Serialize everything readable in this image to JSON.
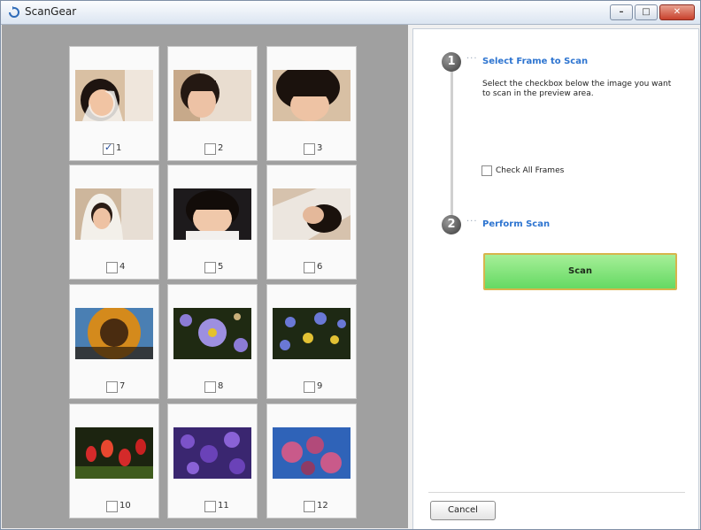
{
  "window": {
    "title": "ScanGear",
    "controls": [
      "minimize",
      "maximize",
      "close"
    ]
  },
  "frames": [
    {
      "number": "1",
      "checked": true
    },
    {
      "number": "2",
      "checked": false
    },
    {
      "number": "3",
      "checked": false
    },
    {
      "number": "4",
      "checked": false
    },
    {
      "number": "5",
      "checked": false
    },
    {
      "number": "6",
      "checked": false
    },
    {
      "number": "7",
      "checked": false
    },
    {
      "number": "8",
      "checked": false
    },
    {
      "number": "9",
      "checked": false
    },
    {
      "number": "10",
      "checked": false
    },
    {
      "number": "11",
      "checked": false
    },
    {
      "number": "12",
      "checked": false
    }
  ],
  "steps": [
    {
      "number": "1",
      "title": "Select Frame to Scan"
    },
    {
      "number": "2",
      "title": "Perform Scan"
    }
  ],
  "instructions": "Select the checkbox below the image you want to scan in the preview area.",
  "check_all_label": "Check All Frames",
  "check_all_checked": false,
  "scan_button": "Scan",
  "cancel_button": "Cancel",
  "colors": {
    "step_title": "#2d74d0",
    "scan_button": "#76e06f",
    "scan_border": "#d7b54c",
    "preview_bg": "#a0a0a0"
  }
}
